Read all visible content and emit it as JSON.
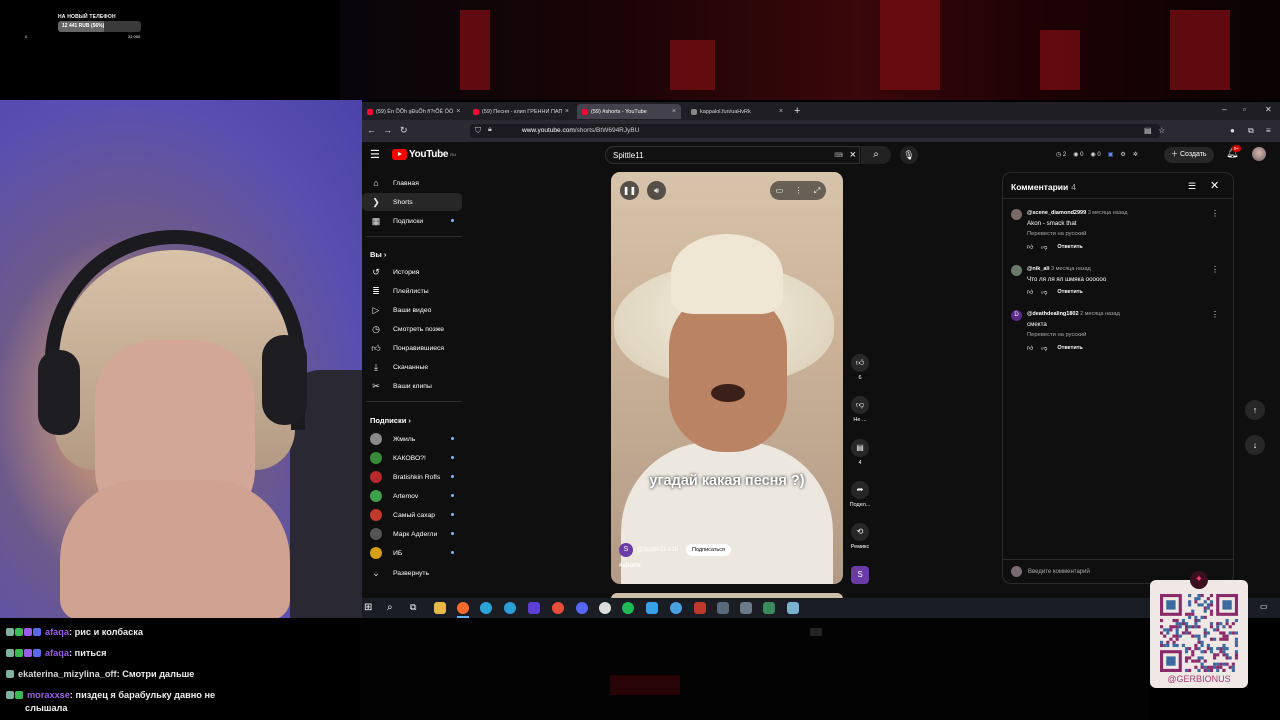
{
  "overlay": {
    "donation_title": "НА НОВЫЙ ТЕЛЕФОН",
    "donation_progress_text": "12 441 RUB (56%)",
    "donation_min": "0",
    "donation_max": "22 000",
    "donation_progress_pct": 56
  },
  "browser": {
    "tabs": [
      {
        "label": "(59) Ёп ÕÕh şÐuÕh ñ?rÕÊ ÔÖ",
        "icon": "youtube-icon"
      },
      {
        "label": "(59) Песня - клип ГРЕННИ ПАПА",
        "icon": "youtube-icon"
      },
      {
        "label": "(59) #shorts - YouTube",
        "icon": "youtube-icon"
      },
      {
        "label": "kappalol.fun/uaHvRk",
        "icon": "globe-icon"
      }
    ],
    "url_prefix": "www.youtube.com",
    "url_path": "/shorts/BtW694RJyBU"
  },
  "youtube": {
    "logo_text": "YouTube",
    "logo_region": "RU",
    "search_query": "Spittle11",
    "search_kbd": "⌨",
    "header_stats": [
      "2",
      "0",
      "0"
    ],
    "create_label": "Создать",
    "notif_badge": "9+",
    "sidebar": {
      "main": [
        {
          "label": "Главная",
          "icon": "home-icon"
        },
        {
          "label": "Shorts",
          "icon": "shorts-icon"
        },
        {
          "label": "Подписки",
          "icon": "subscriptions-icon"
        }
      ],
      "you_heading": "Вы",
      "you": [
        {
          "label": "История",
          "icon": "history-icon"
        },
        {
          "label": "Плейлисты",
          "icon": "playlists-icon"
        },
        {
          "label": "Ваши видео",
          "icon": "your-videos-icon"
        },
        {
          "label": "Смотреть позже",
          "icon": "watch-later-icon"
        },
        {
          "label": "Понравившиеся",
          "icon": "liked-icon"
        },
        {
          "label": "Скачанные",
          "icon": "downloads-icon"
        },
        {
          "label": "Ваши клипы",
          "icon": "clips-icon"
        }
      ],
      "subs_heading": "Подписки",
      "subs": [
        {
          "label": "Жмиль",
          "color": "#8a8a8a"
        },
        {
          "label": "КАКОВО?!",
          "color": "#3a8a3a"
        },
        {
          "label": "Bratishkin Rofls",
          "color": "#b8282c"
        },
        {
          "label": "Artemov",
          "color": "#3aa04a"
        },
        {
          "label": "Самый сахар",
          "color": "#c0392b"
        },
        {
          "label": "Марк Адderли",
          "color": "#555555"
        },
        {
          "label": "ИБ",
          "color": "#d4a017"
        }
      ],
      "expand_label": "Развернуть"
    },
    "video": {
      "caption": "угадай какая песня ?)",
      "channel": "@Spittle11-n1b",
      "channel_initial": "S",
      "subscribe_label": "Подписаться",
      "tag": "#shorts"
    },
    "actions": {
      "likes": "6",
      "dislike_label": "Не ...",
      "comments": "4",
      "share_label": "Подел...",
      "remix_label": "Ремикс"
    },
    "comments": {
      "title": "Комментарии",
      "count": "4",
      "items": [
        {
          "user": "@scene_diamond2999",
          "time": "3 месяца назад",
          "text": "Akon - smack that",
          "translate": "Перевести на русский",
          "initial": "",
          "color": "#7a6a6a"
        },
        {
          "user": "@nik_ali",
          "time": "3 месяца назад",
          "text": "Что ля ля ял шмяка oooooo",
          "translate": "",
          "initial": "",
          "color": "#6a7a6a"
        },
        {
          "user": "@deathdealing1802",
          "time": "2 месяца назад",
          "text": "смекта",
          "translate": "Перевести на русский",
          "initial": "D",
          "color": "#5a2a8a"
        }
      ],
      "reply_label": "Ответить",
      "input_placeholder": "Введите комментарий"
    }
  },
  "chat": [
    {
      "user": "afaqa",
      "user_color": "#9b5de5",
      "text": "рис и колбаска"
    },
    {
      "user": "afaqa",
      "user_color": "#9b5de5",
      "text": "питься"
    },
    {
      "user": "ekaterina_mizylina_off",
      "user_color": "#d8d8d8",
      "text": "Смотри дальше"
    },
    {
      "user": "moraxxse",
      "user_color": "#9b5de5",
      "text": "пиздец я барабульку давно не слышала"
    }
  ],
  "qr": {
    "handle": "@GERBIONUS"
  }
}
